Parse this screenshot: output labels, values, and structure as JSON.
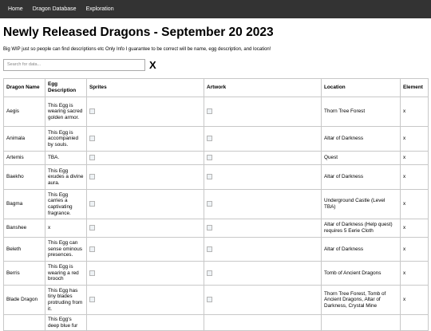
{
  "nav": {
    "items": [
      {
        "label": "Home"
      },
      {
        "label": "Dragon Database"
      },
      {
        "label": "Exploration"
      }
    ]
  },
  "page": {
    "title": "Newly Released Dragons - September 20 2023",
    "intro": "Big WIP just so people can find descriptions etc Only Info I guarantee to be correct will be name, egg description, and location!"
  },
  "search": {
    "placeholder": "Search for data...",
    "clear_label": "X"
  },
  "table": {
    "headers": [
      "Dragon Name",
      "Egg Description",
      "Sprites",
      "Artwork",
      "Location",
      "Element"
    ],
    "rows": [
      {
        "name": "Aegis",
        "egg": "This Egg is wearing sacred golden armor.",
        "location": "Thorn Tree Forest",
        "element": "x"
      },
      {
        "name": "Animala",
        "egg": "This Egg is accompanied by souls.",
        "location": "Altar of Darkness",
        "element": "x"
      },
      {
        "name": "Artemis",
        "egg": "TBA.",
        "location": "Quest",
        "element": "x"
      },
      {
        "name": "Baekho",
        "egg": "This Egg exudes a divine aura.",
        "location": "Altar of Darkness",
        "element": "x"
      },
      {
        "name": "Bagma",
        "egg": "This Egg carries a captivating fragrance.",
        "location": "Underground Castle (Level TBA)",
        "element": "x"
      },
      {
        "name": "Banshee",
        "egg": "x",
        "location": "Altar of Darkness (Help quest) requires 5 Eerie Cloth",
        "element": "x"
      },
      {
        "name": "Beleth",
        "egg": "This Egg can sense ominous presences.",
        "location": "Altar of Darkness",
        "element": "x"
      },
      {
        "name": "Berris",
        "egg": "This Egg is wearing a red brooch",
        "location": "Tomb of Ancient Dragons",
        "element": "x"
      },
      {
        "name": "Blade Dragon",
        "egg": "This Egg has tiny blades protruding from it.",
        "location": "Thorn Tree Forest, Tomb of Ancient Dragons, Altar of Darkness, Crystal Mine",
        "element": "x"
      },
      {
        "name": "",
        "egg": "This Egg's deep blue fur",
        "location": "",
        "element": ""
      }
    ]
  }
}
